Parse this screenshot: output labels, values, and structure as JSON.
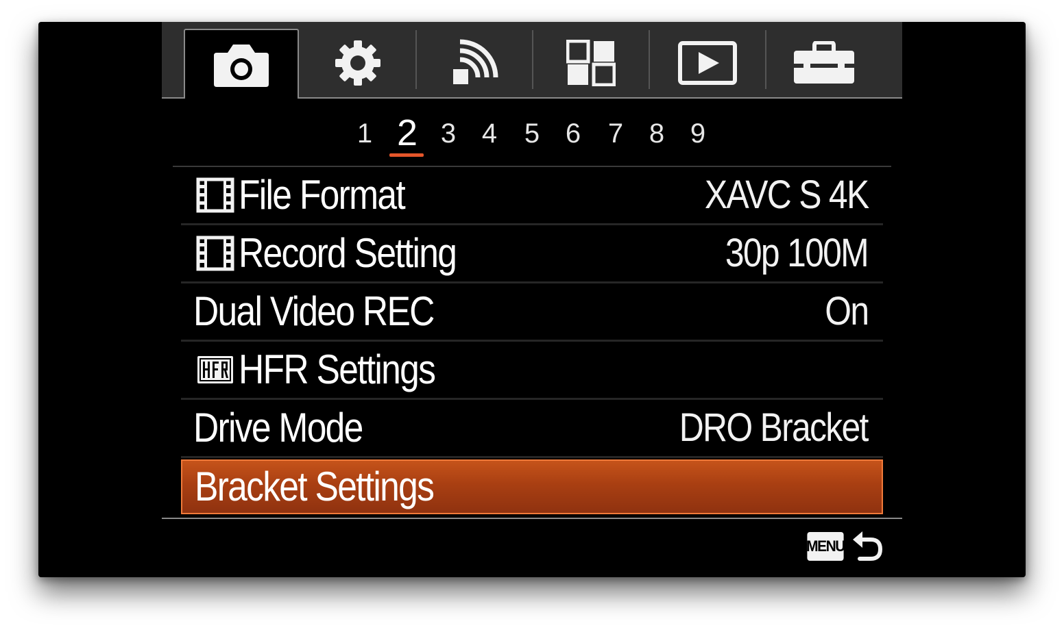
{
  "tabs": [
    {
      "icon": "camera-icon",
      "active": true
    },
    {
      "icon": "gear-icon",
      "active": false
    },
    {
      "icon": "wireless-icon",
      "active": false
    },
    {
      "icon": "grid-icon",
      "active": false
    },
    {
      "icon": "playback-icon",
      "active": false
    },
    {
      "icon": "toolbox-icon",
      "active": false
    }
  ],
  "pages": {
    "numbers": [
      "1",
      "2",
      "3",
      "4",
      "5",
      "6",
      "7",
      "8",
      "9"
    ],
    "active": "2"
  },
  "menu": {
    "items": [
      {
        "label": "File Format",
        "value": "XAVC S 4K",
        "icon": "movie-icon"
      },
      {
        "label": "Record Setting",
        "value": "30p 100M",
        "icon": "movie-icon"
      },
      {
        "label": "Dual Video REC",
        "value": "On",
        "icon": ""
      },
      {
        "label": "HFR Settings",
        "value": "",
        "icon": "hfr-icon"
      },
      {
        "label": "Drive Mode",
        "value": "DRO Bracket",
        "icon": ""
      },
      {
        "label": "Bracket Settings",
        "value": "",
        "icon": "",
        "selected": true
      }
    ]
  },
  "footer": {
    "menu_badge": "MENU",
    "back_icon": "back-arrow-icon"
  },
  "colors": {
    "accent": "#e5562a",
    "selected_row": "#a93f12",
    "tab_bar": "#2e2e2e"
  }
}
